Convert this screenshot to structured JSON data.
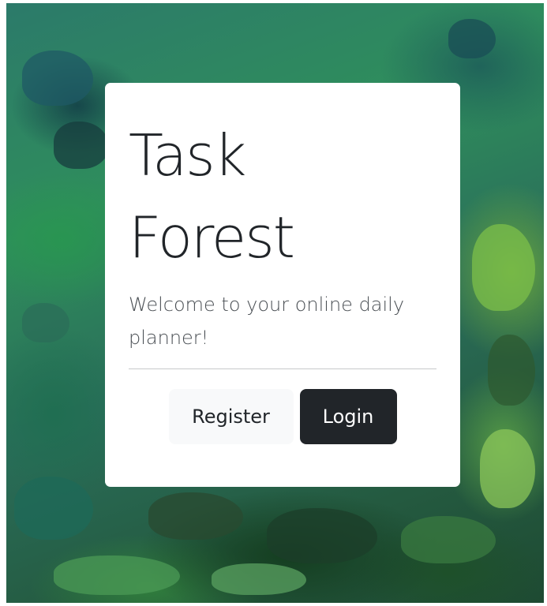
{
  "app": {
    "title_line1": "Task",
    "title_line2": "Forest",
    "tagline": "Welcome to your online daily planner!"
  },
  "actions": {
    "register_label": "Register",
    "login_label": "Login"
  },
  "colors": {
    "card_background": "#ffffff",
    "login_button": "#212529",
    "register_button": "#f8f9fa"
  }
}
